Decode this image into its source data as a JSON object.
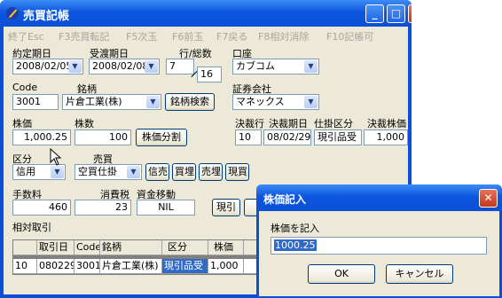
{
  "window": {
    "title": "売買記帳"
  },
  "menu": [
    "終了Esc",
    "F3売買転記",
    "F5次玉",
    "F6前玉",
    "F7戻る",
    "F8相対消除",
    "F10記帳可"
  ],
  "labels": {
    "contract_date": "約定期日",
    "delivery_date": "受渡期日",
    "line_total": "行/総数",
    "account": "口座",
    "code": "Code",
    "brand": "銘柄",
    "securities_company": "証券会社",
    "price": "株価",
    "shares": "株数",
    "settlement_line": "決裁行",
    "settlement_date": "決裁期日",
    "settlement_type": "仕掛区分",
    "settlement_price": "決裁株価",
    "category": "区分",
    "trade": "売買",
    "fee": "手数料",
    "tax": "消費税",
    "fund_transfer": "資金移動",
    "relative_trade": "相対取引"
  },
  "fields": {
    "contract_date": "2008/02/05",
    "delivery_date": "2008/02/08",
    "line": "7",
    "total": "16",
    "account": "カブコム",
    "code": "3001",
    "brand": "片倉工業(株)",
    "securities_company": "マネックス",
    "price": "1,000.25",
    "shares": "100",
    "settlement_line": "10",
    "settlement_date": "08/02/29",
    "settlement_type": "現引品受",
    "settlement_price": "1,000",
    "category": "信用",
    "trade": "空買仕掛",
    "fee": "460",
    "tax": "23",
    "fund_transfer": "NIL"
  },
  "buttons": {
    "brand_search": "銘柄検索",
    "split": "株価分割",
    "short_close": "信売",
    "buy_close": "買埋",
    "sell_close": "売埋",
    "spot_buy": "現買",
    "spot_pull": "現引"
  },
  "table": {
    "columns": [
      "",
      "取引日",
      "Code",
      "銘柄",
      "区分",
      "株価"
    ],
    "rows": [
      [
        "10",
        "080229",
        "3001",
        "片倉工業(株)",
        "現引品受",
        "1,000"
      ]
    ]
  },
  "dialog": {
    "title": "株価記入",
    "prompt": "株価を記入",
    "value": "1000.25",
    "ok": "OK",
    "cancel": "キャンセル"
  }
}
